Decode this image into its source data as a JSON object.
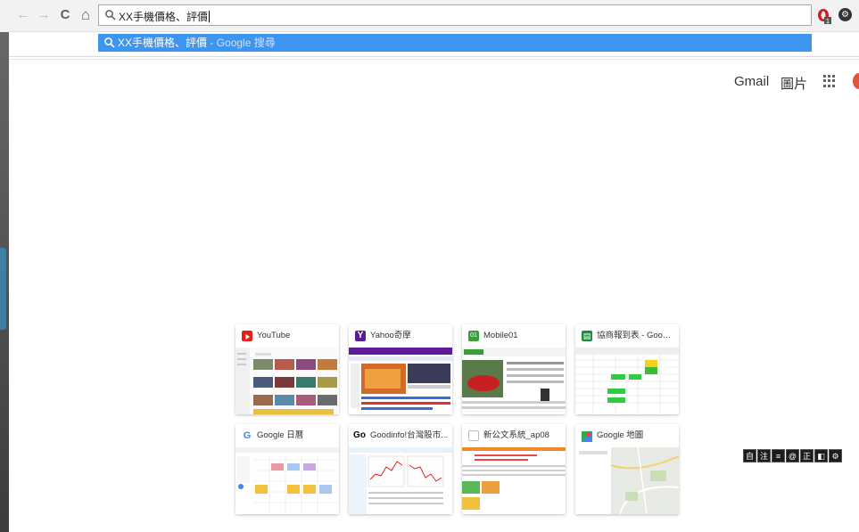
{
  "browser": {
    "address_text": "XX手機價格、評價",
    "suggestion_query": "XX手機價格、評價",
    "suggestion_sub": " - Google 搜尋",
    "nav": {
      "back": "←",
      "forward": "→",
      "reload": "C",
      "home": "⌂"
    },
    "extension_badge": "1",
    "extension_gear": "⚙"
  },
  "google_header": {
    "gmail": "Gmail",
    "images": "圖片"
  },
  "tiles": [
    {
      "title": "YouTube",
      "icon_color": "#e62117",
      "icon_text": "▶"
    },
    {
      "title": "Yahoo奇摩",
      "icon_color": "#5c1b97",
      "icon_text": "Y"
    },
    {
      "title": "Mobile01",
      "icon_color": "#3a9c3a",
      "icon_text": "01"
    },
    {
      "title": "協商報到表 - Googl...",
      "icon_color": "#1e8e3e",
      "icon_text": "▤"
    },
    {
      "title": "Google 日曆",
      "icon_color": "#4285f4",
      "icon_text": "G"
    },
    {
      "title": "Goodinfo!台灣股市...",
      "icon_color": "#000000",
      "icon_text": "Go"
    },
    {
      "title": "新公文系統_ap08",
      "icon_color": "#cccccc",
      "icon_text": ""
    },
    {
      "title": "Google 地圖",
      "icon_color": "#34a853",
      "icon_text": "◆"
    }
  ],
  "mini_toolbar": [
    "自",
    "注",
    "≡",
    "@",
    "正",
    "◧",
    "⚙"
  ]
}
